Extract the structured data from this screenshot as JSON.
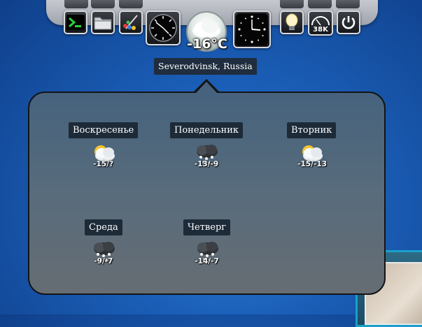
{
  "dock": {
    "items": [
      {
        "name": "terminal",
        "icon": "terminal-icon"
      },
      {
        "name": "files",
        "icon": "folder-icon"
      },
      {
        "name": "paint",
        "icon": "palette-icon"
      },
      {
        "name": "speed",
        "icon": "gauge-icon"
      },
      {
        "name": "clock",
        "icon": "clock-icon"
      },
      {
        "name": "light",
        "icon": "lightbulb-icon"
      },
      {
        "name": "network",
        "icon": "network-meter-icon"
      },
      {
        "name": "power",
        "icon": "power-icon"
      }
    ],
    "network_speed": "38K"
  },
  "weather": {
    "current_temp": "-16°C",
    "location": "Severodvinsk, Russia",
    "forecast": [
      {
        "day": "Воскресенье",
        "temps": "-15/?",
        "icon": "cloudy-sun-icon"
      },
      {
        "day": "Понедельник",
        "temps": "-13/-9",
        "icon": "snow-cloud-icon"
      },
      {
        "day": "Вторник",
        "temps": "-15/-13",
        "icon": "cloudy-sun-icon"
      },
      {
        "day": "Среда",
        "temps": "-9/-7",
        "icon": "snow-cloud-icon"
      },
      {
        "day": "Четверг",
        "temps": "-14/-7",
        "icon": "snow-cloud-icon"
      }
    ]
  },
  "colors": {
    "dock": "#b3b6bd",
    "popup": "#566a7b",
    "label": "#1d2a38",
    "desktop": "#1b5fb8"
  }
}
